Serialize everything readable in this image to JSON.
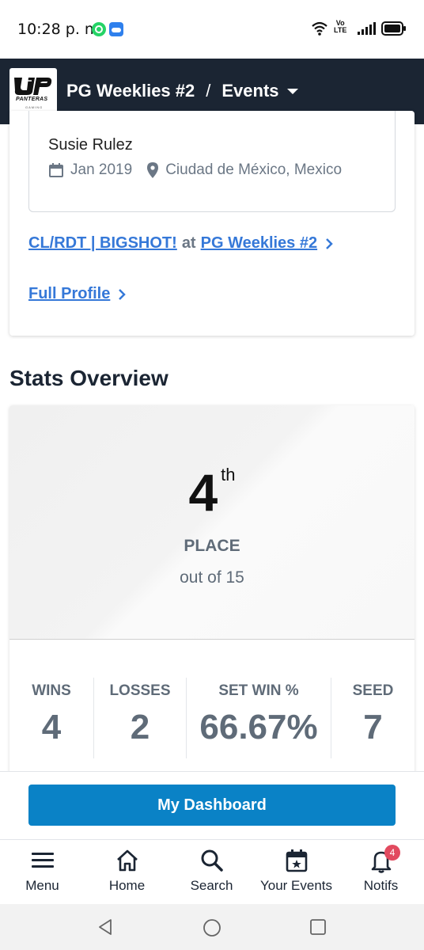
{
  "status_bar": {
    "time": "10:28 p. m.",
    "volte_line1": "Vo",
    "volte_line2": "LTE"
  },
  "header": {
    "logo_text": "PANTERAS",
    "logo_sub": "GAMING",
    "tournament": "PG Weeklies #2",
    "separator": "/",
    "section": "Events"
  },
  "player_card": {
    "name": "Susie Rulez",
    "date": "Jan 2019",
    "location": "Ciudad de México, Mexico",
    "event_name": "CL/RDT | BIGSHOT!",
    "event_at": "at",
    "event_tournament": "PG Weeklies #2",
    "full_profile": "Full Profile"
  },
  "stats": {
    "section_title": "Stats Overview",
    "place": "4",
    "place_suffix": "th",
    "place_label": "PLACE",
    "out_of": "out of 15",
    "columns": [
      {
        "label": "WINS",
        "value": "4"
      },
      {
        "label": "LOSSES",
        "value": "2"
      },
      {
        "label": "SET WIN %",
        "value": "66.67%"
      },
      {
        "label": "SEED",
        "value": "7"
      }
    ]
  },
  "dashboard_button": "My Dashboard",
  "bottom_nav": [
    {
      "label": "Menu",
      "icon": "menu-icon"
    },
    {
      "label": "Home",
      "icon": "home-icon"
    },
    {
      "label": "Search",
      "icon": "search-icon"
    },
    {
      "label": "Your Events",
      "icon": "calendar-star-icon"
    },
    {
      "label": "Notifs",
      "icon": "bell-icon",
      "badge": "4"
    }
  ],
  "colors": {
    "header_bg": "#1b2533",
    "link": "#3578d8",
    "primary_button": "#0a82c6",
    "badge": "#e24a5f"
  }
}
